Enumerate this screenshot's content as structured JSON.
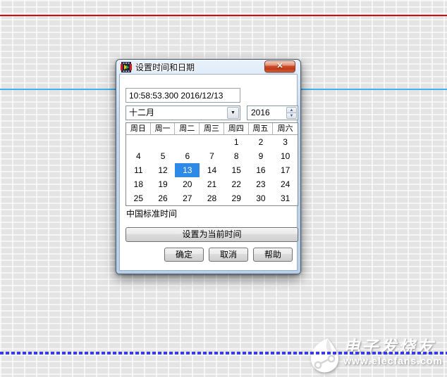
{
  "window": {
    "title": "设置时间和日期"
  },
  "icons": {
    "close": "✕",
    "dropdown": "▼",
    "spin_up": "▲",
    "spin_down": "▼"
  },
  "fields": {
    "datetime": "10:58:53.300 2016/12/13",
    "month": "十二月",
    "year": "2016"
  },
  "calendar": {
    "headers": [
      "周日",
      "周一",
      "周二",
      "周三",
      "周四",
      "周五",
      "周六"
    ],
    "rows": [
      [
        "",
        "",
        "",
        "",
        "1",
        "2",
        "3"
      ],
      [
        "4",
        "5",
        "6",
        "7",
        "8",
        "9",
        "10"
      ],
      [
        "11",
        "12",
        "13",
        "14",
        "15",
        "16",
        "17"
      ],
      [
        "18",
        "19",
        "20",
        "21",
        "22",
        "23",
        "24"
      ],
      [
        "25",
        "26",
        "27",
        "28",
        "29",
        "30",
        "31"
      ]
    ],
    "selected_day": "13"
  },
  "labels": {
    "timezone": "中国标准时间"
  },
  "buttons": {
    "set_current": "设置为当前时间",
    "ok": "确定",
    "cancel": "取消",
    "help": "帮助"
  },
  "watermark": {
    "brand": "电子发烧友",
    "url": "www.elecfans.com"
  },
  "colors": {
    "selection_blue": "#2e8ae6",
    "wire_red": "#d20b0b",
    "wire_blue": "#41b2ef",
    "wire_dotted_blue": "#3a3ae8",
    "close_button_red": "#bf3a18",
    "background_gray": "#e4e4e4"
  }
}
